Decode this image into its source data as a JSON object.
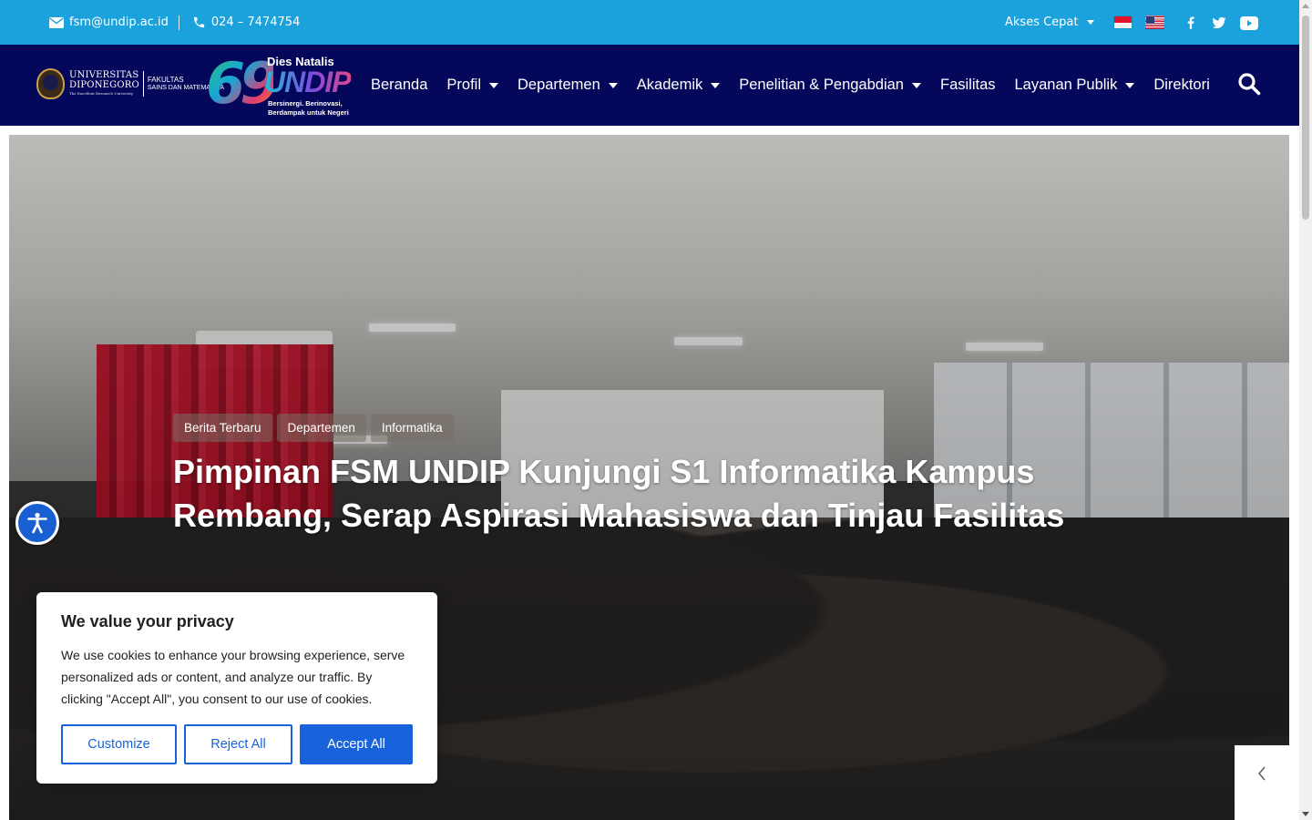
{
  "topbar": {
    "email": "fsm@undip.ac.id",
    "phone": "024 – 7474754",
    "quick_access_label": "Akses Cepat",
    "icons": {
      "email": "envelope-icon",
      "phone": "phone-icon",
      "flag_id": "indonesia-flag-icon",
      "flag_en": "usa-flag-icon",
      "facebook": "facebook-icon",
      "twitter": "twitter-icon",
      "youtube": "youtube-icon"
    },
    "color": "#1ba1dc"
  },
  "logo": {
    "univ_line1": "UNIVERSITAS",
    "univ_line2": "DIPONEGORO",
    "univ_tagline": "The Excellent Research University",
    "faculty_line1": "FAKULTAS",
    "faculty_line2": "SAINS DAN MATEMATIKA",
    "dies_number": "69",
    "dies_title": "Dies Natalis",
    "dies_word": "UNDIP",
    "dies_tagline1": "Bersinergi. Berinovasi,",
    "dies_tagline2": "Berdampak untuk Negeri"
  },
  "nav": {
    "color": "#05075a",
    "items": [
      {
        "label": "Beranda",
        "has_dropdown": false
      },
      {
        "label": "Profil",
        "has_dropdown": true
      },
      {
        "label": "Departemen",
        "has_dropdown": true
      },
      {
        "label": "Akademik",
        "has_dropdown": true
      },
      {
        "label": "Penelitian & Pengabdian",
        "has_dropdown": true
      },
      {
        "label": "Fasilitas",
        "has_dropdown": false
      },
      {
        "label": "Layanan Publik",
        "has_dropdown": true
      },
      {
        "label": "Direktori",
        "has_dropdown": false
      }
    ],
    "search_icon": "search-icon"
  },
  "hero": {
    "tags": [
      "Berita Terbaru",
      "Departemen",
      "Informatika"
    ],
    "title": "Pimpinan FSM UNDIP Kunjungi S1 Informatika Kampus Rembang, Serap Aspirasi Mahasiswa dan Tinjau Fasilitas",
    "prev_icon": "chevron-left-icon"
  },
  "accessibility": {
    "icon": "accessibility-icon",
    "color": "#1a5fd1"
  },
  "cookie": {
    "title": "We value your privacy",
    "body": "We use cookies to enhance your browsing experience, serve personalized ads or content, and analyze our traffic. By clicking \"Accept All\", you consent to our use of cookies.",
    "customize_label": "Customize",
    "reject_label": "Reject All",
    "accept_label": "Accept All",
    "accent": "#1863dc"
  }
}
